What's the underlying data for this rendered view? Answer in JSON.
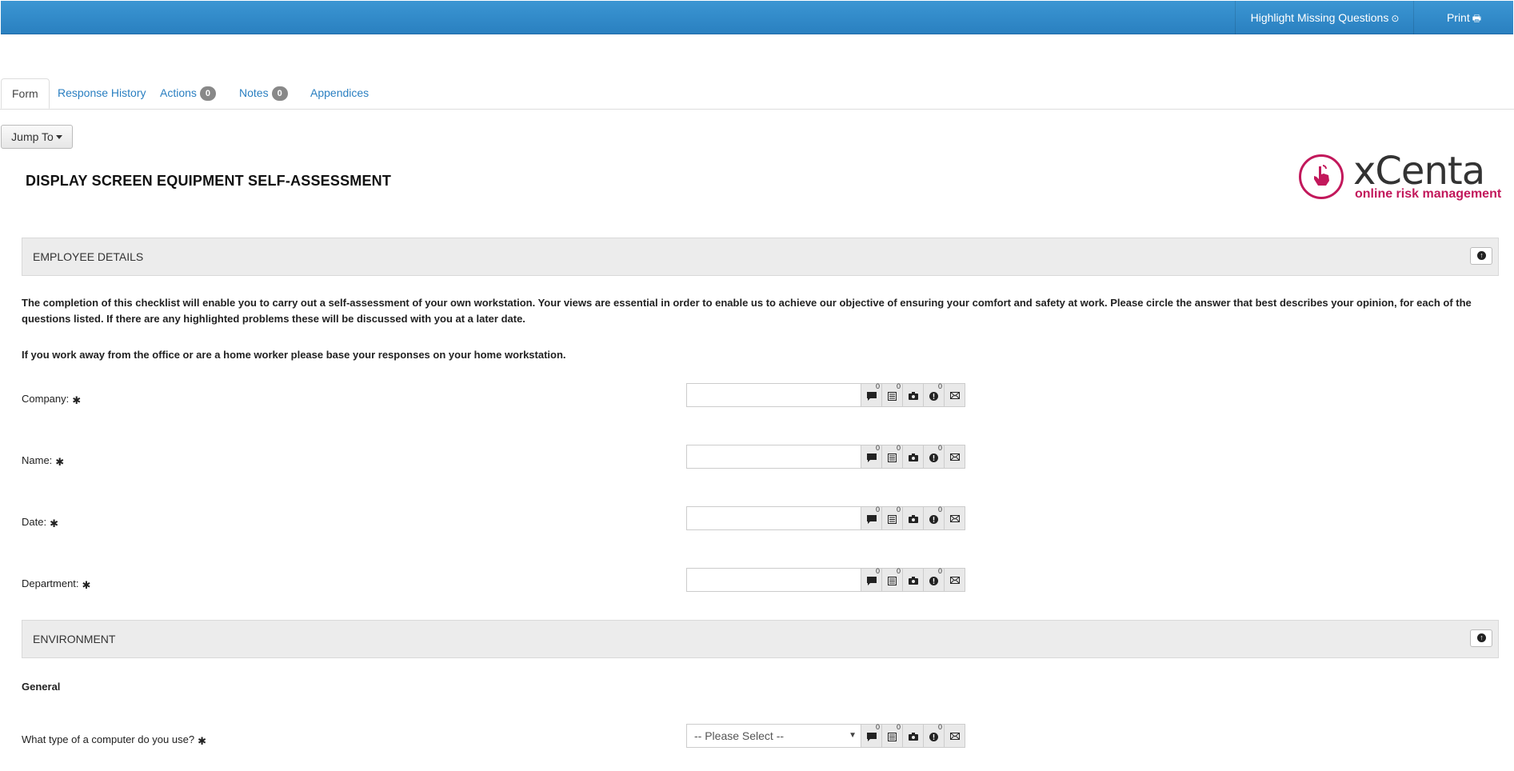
{
  "topbar": {
    "highlight_label": "Highlight Missing Questions",
    "print_label": "Print",
    "color": "#3a93d0"
  },
  "tabs": [
    {
      "label": "Form",
      "active": true
    },
    {
      "label": "Response History"
    },
    {
      "label": "Actions",
      "badge": "0"
    },
    {
      "label": "Notes",
      "badge": "0"
    },
    {
      "label": "Appendices"
    }
  ],
  "jump_to": {
    "label": "Jump To"
  },
  "page_title": "DISPLAY SCREEN EQUIPMENT SELF-ASSESSMENT",
  "logo": {
    "name": "xCenta",
    "tagline": "online risk management",
    "color": "#c2185b"
  },
  "sections": [
    {
      "title": "EMPLOYEE DETAILS"
    },
    {
      "title": "ENVIRONMENT"
    }
  ],
  "intro": {
    "paragraph1": "The completion of this checklist will enable you to carry out a self-assessment of your own workstation. Your views are essential in order to enable us to achieve our objective of ensuring your comfort and safety at work. Please circle the answer that best describes your opinion, for each of the questions listed. If there are any highlighted problems these will be discussed with you at a later date.",
    "paragraph2": "If you work away from the office or are a home worker please base your responses on your home workstation."
  },
  "questions": [
    {
      "label": "Company:",
      "value": "",
      "comments": "0",
      "notes": "0",
      "actions": "0"
    },
    {
      "label": "Name:",
      "value": "",
      "comments": "0",
      "notes": "0",
      "actions": "0"
    },
    {
      "label": "Date:",
      "value": "",
      "comments": "0",
      "notes": "0",
      "actions": "0"
    },
    {
      "label": "Department:",
      "value": "",
      "comments": "0",
      "notes": "0",
      "actions": "0"
    }
  ],
  "environment": {
    "subheading": "General",
    "question": {
      "label": "What type of a computer do you use?",
      "selected": "-- Please Select --",
      "comments": "0",
      "notes": "0",
      "actions": "0"
    }
  }
}
